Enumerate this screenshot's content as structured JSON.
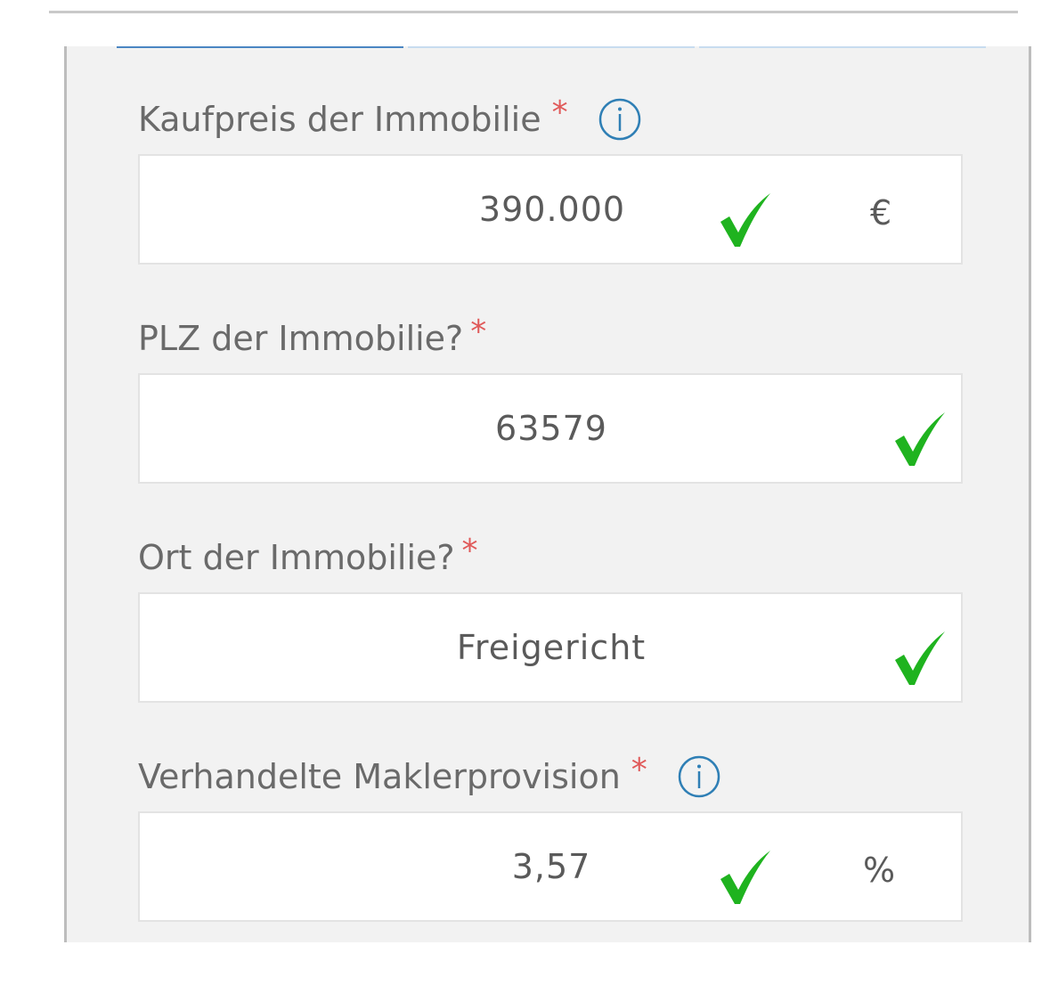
{
  "fields": {
    "purchase_price": {
      "label": "Kaufpreis der Immobilie",
      "required_mark": "*",
      "value": "390.000",
      "unit": "€",
      "valid": true
    },
    "postal_code": {
      "label": "PLZ der Immobilie?",
      "required_mark": "*",
      "value": "63579",
      "valid": true
    },
    "city": {
      "label": "Ort der Immobilie?",
      "required_mark": "*",
      "value": "Freigericht",
      "valid": true
    },
    "broker_commission": {
      "label": "Verhandelte Maklerprovision",
      "required_mark": "*",
      "value": "3,57",
      "unit": "%",
      "valid": true
    }
  },
  "icons": {
    "info": "info-circle-icon",
    "check": "checkmark-icon"
  },
  "colors": {
    "required": "#e05a5a",
    "info": "#2f7fb5",
    "check": "#1fb31f",
    "label_text": "#6a6a6a",
    "panel_bg": "#f2f2f2"
  }
}
